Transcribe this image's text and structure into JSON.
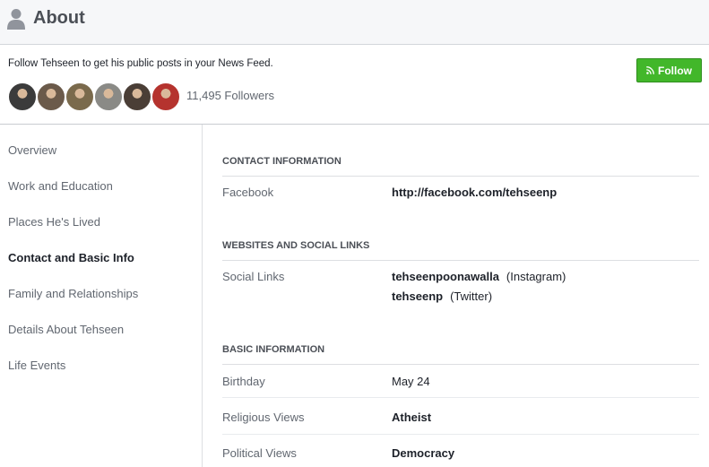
{
  "header": {
    "title": "About",
    "icon": "person-icon"
  },
  "follow": {
    "prompt": "Follow Tehseen to get his public posts in your News Feed.",
    "followers": "11,495 Followers",
    "button_label": "Follow",
    "button_color": "#42b72a",
    "avatars": [
      {
        "name": "follower-avatar-1",
        "color": "#3b3b3b"
      },
      {
        "name": "follower-avatar-2",
        "color": "#6b5a4a"
      },
      {
        "name": "follower-avatar-3",
        "color": "#7a6a4c"
      },
      {
        "name": "follower-avatar-4",
        "color": "#8a8a86"
      },
      {
        "name": "follower-avatar-5",
        "color": "#4a3e36"
      },
      {
        "name": "follower-avatar-6",
        "color": "#b5332e"
      }
    ]
  },
  "sidebar": {
    "items": [
      {
        "label": "Overview",
        "active": false
      },
      {
        "label": "Work and Education",
        "active": false
      },
      {
        "label": "Places He's Lived",
        "active": false
      },
      {
        "label": "Contact and Basic Info",
        "active": true
      },
      {
        "label": "Family and Relationships",
        "active": false
      },
      {
        "label": "Details About Tehseen",
        "active": false
      },
      {
        "label": "Life Events",
        "active": false
      }
    ]
  },
  "contact": {
    "heading": "CONTACT INFORMATION",
    "facebook_label": "Facebook",
    "facebook_value": "http://facebook.com/tehseenp"
  },
  "websites": {
    "heading": "WEBSITES AND SOCIAL LINKS",
    "social_label": "Social Links",
    "links": [
      {
        "handle": "tehseenpoonawalla",
        "network": "(Instagram)"
      },
      {
        "handle": "tehseenp",
        "network": "(Twitter)"
      }
    ]
  },
  "basic": {
    "heading": "BASIC INFORMATION",
    "rows": [
      {
        "label": "Birthday",
        "value": "May 24",
        "bold": false
      },
      {
        "label": "Religious Views",
        "value": "Atheist",
        "bold": true
      },
      {
        "label": "Political Views",
        "value": "Democracy",
        "bold": true
      }
    ]
  }
}
